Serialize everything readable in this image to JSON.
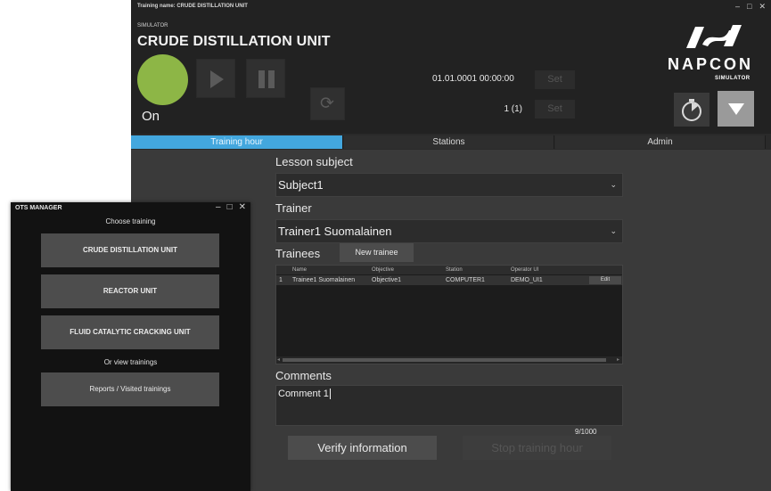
{
  "sim_window": {
    "training_name": "Training name:  CRUDE DISTILLATION UNIT",
    "simulator_label": "SIMULATOR",
    "unit_name": "CRUDE DISTILLATION UNIT",
    "status": "On",
    "datetime": "01.01.0001 00:00:00",
    "counter": "1 (1)",
    "set_label_1": "Set",
    "set_label_2": "Set",
    "logo_text": "NAPCON",
    "logo_sub": "SIMULATOR",
    "colors": {
      "status_on": "#8db646",
      "accent_tab": "#43a7de"
    }
  },
  "tabs": [
    {
      "label": "Training hour",
      "active": true
    },
    {
      "label": "Stations",
      "active": false
    },
    {
      "label": "Admin",
      "active": false
    }
  ],
  "form": {
    "lesson_subject_label": "Lesson subject",
    "lesson_subject_value": "Subject1",
    "trainer_label": "Trainer",
    "trainer_value": "Trainer1 Suomalainen",
    "trainees_label": "Trainees",
    "new_trainee_label": "New trainee",
    "columns": [
      "Name",
      "Objective",
      "Station",
      "Operator UI"
    ],
    "rows": [
      {
        "index": "1",
        "name": "Trainee1 Suomalainen",
        "objective": "Objective1",
        "station": "COMPUTER1",
        "operator_ui": "DEMO_UI1",
        "action": "Edit"
      }
    ],
    "comments_label": "Comments",
    "comment_text": "Comment 1",
    "char_count": "9/1000",
    "verify_label": "Verify information",
    "stop_label": "Stop training hour"
  },
  "ots_manager": {
    "title": "OTS MANAGER",
    "choose_training": "Choose training",
    "units": [
      "CRUDE DISTILLATION UNIT",
      "REACTOR UNIT",
      "FLUID CATALYTIC CRACKING UNIT"
    ],
    "or_view": "Or view trainings",
    "reports_label": "Reports / Visited trainings"
  }
}
